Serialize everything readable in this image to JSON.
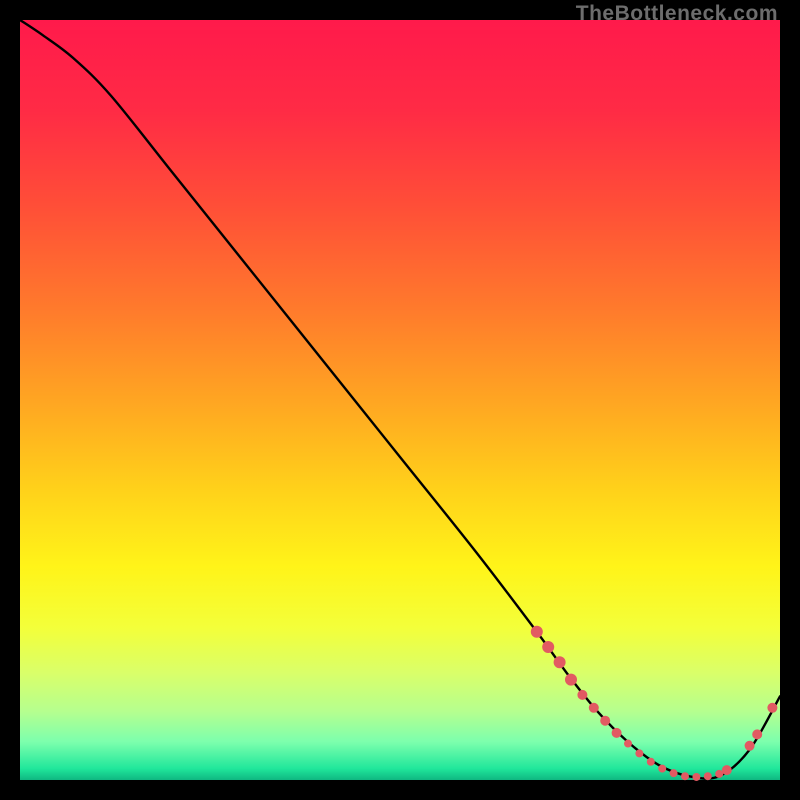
{
  "watermark": {
    "text": "TheBottleneck.com",
    "color": "#6d6d6d",
    "font_size_px": 21
  },
  "colors": {
    "background": "#000000",
    "line": "#000000",
    "point_fill": "#e25a62",
    "point_stroke": "#e25a62",
    "gradient_stops": [
      {
        "pos": 0.0,
        "color": "#ff1a4b"
      },
      {
        "pos": 0.12,
        "color": "#ff2b45"
      },
      {
        "pos": 0.25,
        "color": "#ff5037"
      },
      {
        "pos": 0.38,
        "color": "#ff7a2c"
      },
      {
        "pos": 0.5,
        "color": "#ffa522"
      },
      {
        "pos": 0.62,
        "color": "#ffd21a"
      },
      {
        "pos": 0.72,
        "color": "#fff419"
      },
      {
        "pos": 0.8,
        "color": "#f3ff3a"
      },
      {
        "pos": 0.86,
        "color": "#d9ff6a"
      },
      {
        "pos": 0.91,
        "color": "#b5ff8f"
      },
      {
        "pos": 0.95,
        "color": "#7cffad"
      },
      {
        "pos": 0.985,
        "color": "#20e79b"
      },
      {
        "pos": 1.0,
        "color": "#0fb781"
      }
    ]
  },
  "chart_data": {
    "type": "line",
    "title": "",
    "xlabel": "",
    "ylabel": "",
    "xlim": [
      0,
      100
    ],
    "ylim": [
      0,
      100
    ],
    "grid": false,
    "legend": false,
    "series": [
      {
        "name": "bottleneck-curve",
        "x": [
          0,
          3,
          7,
          12,
          20,
          30,
          40,
          50,
          60,
          68,
          72,
          76,
          80,
          84,
          88,
          92,
          96,
          100
        ],
        "y": [
          100,
          98,
          95,
          90,
          80,
          67.5,
          55,
          42.5,
          30,
          19.5,
          14,
          9,
          5,
          2,
          0.5,
          0.5,
          4,
          11
        ]
      }
    ],
    "points": [
      {
        "x": 68.0,
        "y": 19.5,
        "r": 6
      },
      {
        "x": 69.5,
        "y": 17.5,
        "r": 6
      },
      {
        "x": 71.0,
        "y": 15.5,
        "r": 6
      },
      {
        "x": 72.5,
        "y": 13.2,
        "r": 6
      },
      {
        "x": 74.0,
        "y": 11.2,
        "r": 5
      },
      {
        "x": 75.5,
        "y": 9.5,
        "r": 5
      },
      {
        "x": 77.0,
        "y": 7.8,
        "r": 5
      },
      {
        "x": 78.5,
        "y": 6.2,
        "r": 5
      },
      {
        "x": 80.0,
        "y": 4.8,
        "r": 4
      },
      {
        "x": 81.5,
        "y": 3.5,
        "r": 4
      },
      {
        "x": 83.0,
        "y": 2.4,
        "r": 4
      },
      {
        "x": 84.5,
        "y": 1.5,
        "r": 4
      },
      {
        "x": 86.0,
        "y": 0.9,
        "r": 4
      },
      {
        "x": 87.5,
        "y": 0.5,
        "r": 4
      },
      {
        "x": 89.0,
        "y": 0.4,
        "r": 4
      },
      {
        "x": 90.5,
        "y": 0.5,
        "r": 4
      },
      {
        "x": 92.0,
        "y": 0.8,
        "r": 4
      },
      {
        "x": 93.0,
        "y": 1.3,
        "r": 5
      },
      {
        "x": 96.0,
        "y": 4.5,
        "r": 5
      },
      {
        "x": 97.0,
        "y": 6.0,
        "r": 5
      },
      {
        "x": 99.0,
        "y": 9.5,
        "r": 5
      }
    ]
  }
}
